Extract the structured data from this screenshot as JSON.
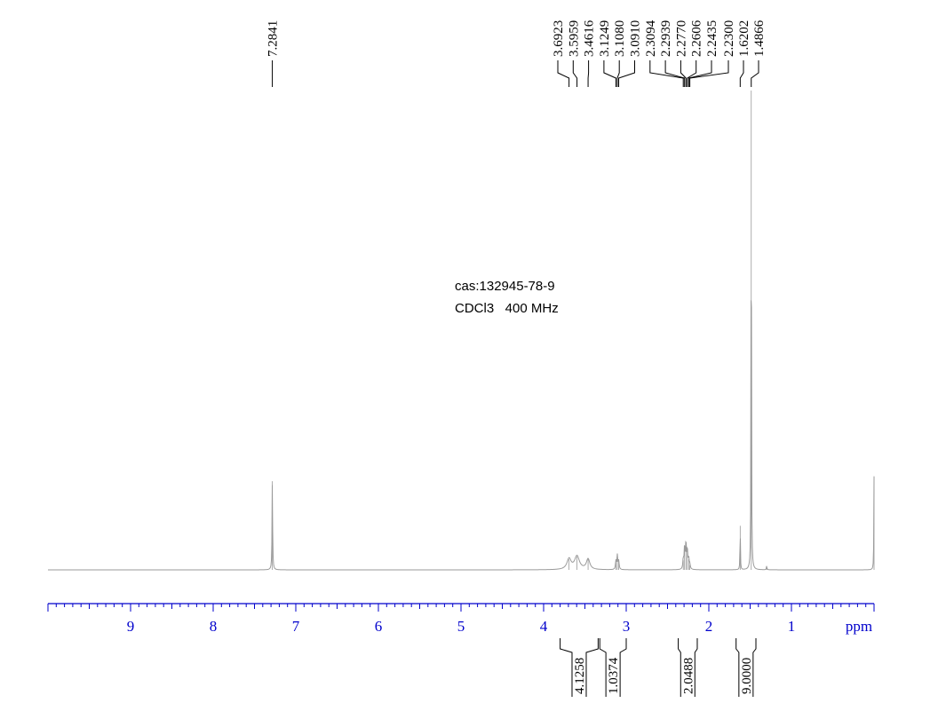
{
  "annotations": {
    "cas": "cas:132945-78-9",
    "conditions": "CDCl3   400 MHz"
  },
  "chart_data": {
    "type": "line",
    "title": "",
    "xlabel": "ppm",
    "ylabel": "",
    "x_reversed": true,
    "xlim": [
      10.0,
      0.0
    ],
    "x_ticks": [
      9,
      8,
      7,
      6,
      5,
      4,
      3,
      2,
      1
    ],
    "x_tick_labels": [
      "9",
      "8",
      "7",
      "6",
      "5",
      "4",
      "3",
      "2",
      "1"
    ],
    "grid": false,
    "colors": {
      "axis": "#0000cc",
      "trace": "#9a9a9a",
      "labels": "#000000"
    },
    "peaks": [
      {
        "ppm": 7.2841,
        "height": 0.185,
        "width": 0.004
      },
      {
        "ppm": 3.6923,
        "height": 0.022,
        "width": 0.03
      },
      {
        "ppm": 3.5959,
        "height": 0.028,
        "width": 0.035
      },
      {
        "ppm": 3.4616,
        "height": 0.022,
        "width": 0.025
      },
      {
        "ppm": 3.1249,
        "height": 0.018,
        "width": 0.006
      },
      {
        "ppm": 3.108,
        "height": 0.03,
        "width": 0.006
      },
      {
        "ppm": 3.091,
        "height": 0.018,
        "width": 0.006
      },
      {
        "ppm": 2.3094,
        "height": 0.02,
        "width": 0.006
      },
      {
        "ppm": 2.2939,
        "height": 0.045,
        "width": 0.006
      },
      {
        "ppm": 2.277,
        "height": 0.055,
        "width": 0.006
      },
      {
        "ppm": 2.2606,
        "height": 0.04,
        "width": 0.006
      },
      {
        "ppm": 2.2435,
        "height": 0.022,
        "width": 0.006
      },
      {
        "ppm": 2.23,
        "height": 0.01,
        "width": 0.006
      },
      {
        "ppm": 1.6202,
        "height": 0.092,
        "width": 0.003
      },
      {
        "ppm": 1.4866,
        "height": 1.0,
        "width": 0.003
      },
      {
        "ppm": 1.3,
        "height": 0.008,
        "width": 0.004
      },
      {
        "ppm": 0.0,
        "height": 0.195,
        "width": 0.003
      }
    ],
    "peak_labels": [
      {
        "label": "7.2841",
        "ppm": 7.2841
      },
      {
        "label": "3.6923",
        "ppm": 3.6923
      },
      {
        "label": "3.5959",
        "ppm": 3.5959
      },
      {
        "label": "3.4616",
        "ppm": 3.4616
      },
      {
        "label": "3.1249",
        "ppm": 3.1249
      },
      {
        "label": "3.1080",
        "ppm": 3.108
      },
      {
        "label": "3.0910",
        "ppm": 3.091
      },
      {
        "label": "2.3094",
        "ppm": 2.3094
      },
      {
        "label": "2.2939",
        "ppm": 2.2939
      },
      {
        "label": "2.2770",
        "ppm": 2.277
      },
      {
        "label": "2.2606",
        "ppm": 2.2606
      },
      {
        "label": "2.2435",
        "ppm": 2.2435
      },
      {
        "label": "2.2300",
        "ppm": 2.23
      },
      {
        "label": "1.6202",
        "ppm": 1.6202
      },
      {
        "label": "1.4866",
        "ppm": 1.4866
      }
    ],
    "integrals": [
      {
        "label": "4.1258",
        "from": 3.8,
        "to": 3.34
      },
      {
        "label": "1.0374",
        "from": 3.32,
        "to": 3.0
      },
      {
        "label": "2.0488",
        "from": 2.37,
        "to": 2.14
      },
      {
        "label": "9.0000",
        "from": 1.67,
        "to": 1.43
      }
    ]
  }
}
